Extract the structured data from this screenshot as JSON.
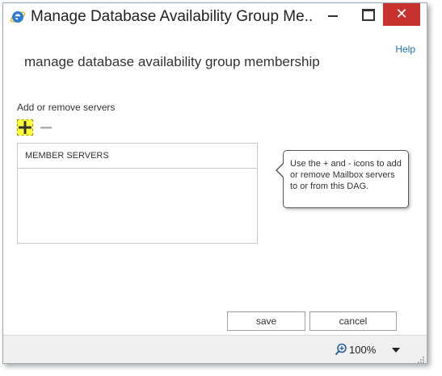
{
  "window": {
    "title": "Manage Database Availability Group Me...",
    "close_glyph": "✕"
  },
  "header": {
    "help_label": "Help",
    "page_title": "manage database availability group membership"
  },
  "servers": {
    "section_label": "Add or remove servers",
    "add_icon": "plus-icon",
    "remove_icon": "minus-icon",
    "column_header": "MEMBER SERVERS",
    "rows": []
  },
  "callout": {
    "text": "Use the + and - icons to add or remove Mailbox servers to or from this DAG."
  },
  "actions": {
    "save_label": "save",
    "cancel_label": "cancel"
  },
  "statusbar": {
    "zoom_level": "100%"
  },
  "colors": {
    "accent_link": "#1e6fb5",
    "close_button": "#c7322e",
    "add_highlight": "#ffff3a",
    "ie_icon": "#2b7bd3"
  }
}
